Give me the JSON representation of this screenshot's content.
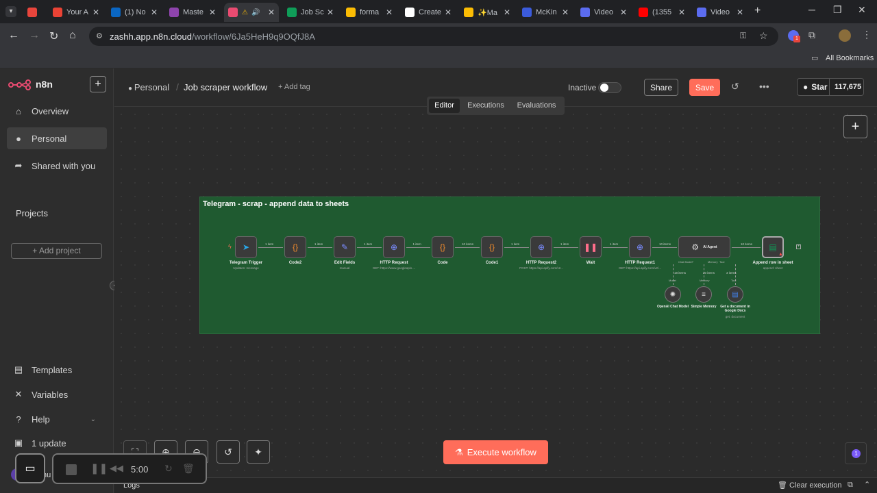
{
  "browser": {
    "tabs": [
      {
        "label": "",
        "icon": "record-icon",
        "color": "#e8453c"
      },
      {
        "label": "Your A",
        "icon": "gmail-icon",
        "color": "#ea4335"
      },
      {
        "label": "(1) No",
        "icon": "linkedin-icon",
        "color": "#0a66c2"
      },
      {
        "label": "Maste",
        "icon": "u-icon",
        "color": "#8e44ad"
      },
      {
        "label": "",
        "icon": "n8n-icon",
        "color": "#ea4b71",
        "active": true
      },
      {
        "label": "Job Sc",
        "icon": "sheets-icon",
        "color": "#0f9d58"
      },
      {
        "label": "forma",
        "icon": "ads-icon",
        "color": "#fbbc04"
      },
      {
        "label": "Create",
        "icon": "chatgpt-icon",
        "color": "#ffffff"
      },
      {
        "label": "✨Ma",
        "icon": "drive-icon",
        "color": "#fbbc04"
      },
      {
        "label": "McKin",
        "icon": "xm-icon",
        "color": "#3b5bdb"
      },
      {
        "label": "Video",
        "icon": "sparkle-icon",
        "color": "#5b6cf0"
      },
      {
        "label": "(1355",
        "icon": "youtube-icon",
        "color": "#ff0000"
      },
      {
        "label": "Video",
        "icon": "sparkle-icon",
        "color": "#5b6cf0"
      }
    ],
    "url_host": "zashh.app.n8n.cloud",
    "url_path": "/workflow/6Ja5HeH9q9OQfJ8A",
    "bookmarks_label": "All Bookmarks"
  },
  "sidebar": {
    "brand": "n8n",
    "items": [
      {
        "label": "Overview",
        "icon": "home-icon"
      },
      {
        "label": "Personal",
        "icon": "user-icon"
      },
      {
        "label": "Shared with you",
        "icon": "share-icon"
      }
    ],
    "projects_heading": "Projects",
    "add_project": "Add project",
    "bottom": [
      {
        "label": "Templates",
        "icon": "templates-icon"
      },
      {
        "label": "Variables",
        "icon": "variables-icon"
      },
      {
        "label": "Help",
        "icon": "help-icon"
      },
      {
        "label": "1 update",
        "icon": "gift-icon"
      }
    ],
    "user_initial": "S",
    "user_name": "hu"
  },
  "header": {
    "breadcrumb_owner": "Personal",
    "workflow_name": "Job scraper workflow",
    "add_tag": "+ Add tag",
    "status": "Inactive",
    "share": "Share",
    "save": "Save",
    "github_star": "Star",
    "github_count": "117,675",
    "tabs": [
      "Editor",
      "Executions",
      "Evaluations"
    ]
  },
  "canvas": {
    "sticky_title": "Telegram - scrap - append data to sheets",
    "nodes": [
      {
        "name": "Telegram Trigger",
        "sub": "Updates: message",
        "icon": "telegram-icon"
      },
      {
        "name": "Code2",
        "sub": "",
        "icon": "code-icon"
      },
      {
        "name": "Edit Fields",
        "sub": "manual",
        "icon": "pencil-icon"
      },
      {
        "name": "HTTP Request",
        "sub": "GET: https://www.googleapis....",
        "icon": "globe-icon"
      },
      {
        "name": "Code",
        "sub": "",
        "icon": "code-icon"
      },
      {
        "name": "Code1",
        "sub": "",
        "icon": "code-icon"
      },
      {
        "name": "HTTP Request2",
        "sub": "POST: https://api.apify.com/v2...",
        "icon": "globe-icon"
      },
      {
        "name": "Wait",
        "sub": "",
        "icon": "pause-icon"
      },
      {
        "name": "HTTP Request1",
        "sub": "GET: https://api.apify.com/v2/...",
        "icon": "globe-icon"
      },
      {
        "name": "AI Agent",
        "sub": "",
        "icon": "robot-icon"
      },
      {
        "name": "Append row in sheet",
        "sub": "append: sheet",
        "icon": "sheets-icon"
      }
    ],
    "edge_labels": [
      "1 item",
      "1 item",
      "1 item",
      "1 item",
      "10 items",
      "1 item",
      "1 item",
      "1 item",
      "10 items",
      "10 items"
    ],
    "agent_ports": [
      "Chat Model*",
      "Memory",
      "Tool"
    ],
    "sub_edge_labels": [
      "18 items",
      "20 items",
      "3 items"
    ],
    "sub_nodes": [
      {
        "name": "OpenAI Chat Model",
        "sub": "",
        "port": "Model",
        "icon": "openai-icon"
      },
      {
        "name": "Simple Memory",
        "sub": "",
        "port": "Memory",
        "icon": "database-icon"
      },
      {
        "name": "Get a document in Google Docs",
        "sub": "get: document",
        "port": "Tool",
        "icon": "docs-icon"
      }
    ],
    "execute_button": "Execute workflow",
    "logs_label": "Logs",
    "clear_execution": "Clear execution",
    "timer": "5:00",
    "badge_count": "1"
  }
}
